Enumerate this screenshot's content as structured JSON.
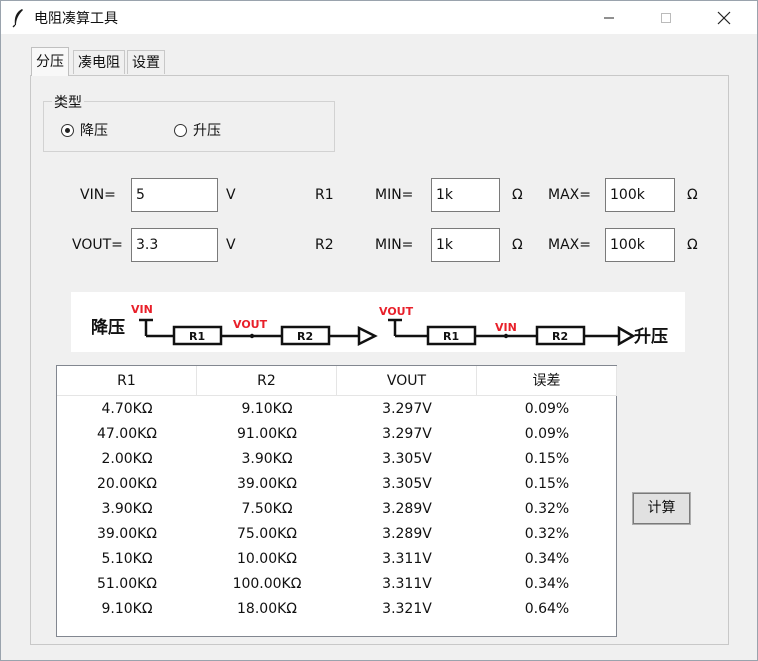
{
  "window": {
    "title": "电阻凑算工具",
    "min_icon": "minimize-icon",
    "max_icon": "maximize-icon",
    "close_icon": "close-icon"
  },
  "tabs": [
    {
      "label": "分压",
      "active": true
    },
    {
      "label": "凑电阻",
      "active": false
    },
    {
      "label": "设置",
      "active": false
    }
  ],
  "type_group": {
    "label": "类型",
    "options": [
      {
        "label": "降压",
        "checked": true
      },
      {
        "label": "升压",
        "checked": false
      }
    ]
  },
  "inputs": {
    "vin_label": "VIN=",
    "vin_value": "5",
    "vin_unit": "V",
    "vout_label": "VOUT=",
    "vout_value": "3.3",
    "vout_unit": "V",
    "r1_label": "R1",
    "r2_label": "R2",
    "min_label": "MIN=",
    "max_label": "MAX=",
    "r1_min": "1k",
    "r1_max": "100k",
    "r2_min": "1k",
    "r2_max": "100k",
    "ohm": "Ω"
  },
  "diagram": {
    "buck_label": "降压",
    "boost_label": "升压",
    "vin": "VIN",
    "vout": "VOUT",
    "r1": "R1",
    "r2": "R2",
    "red": "#e8202a"
  },
  "table": {
    "headers": [
      "R1",
      "R2",
      "VOUT",
      "误差"
    ],
    "rows": [
      [
        "4.70KΩ",
        "9.10KΩ",
        "3.297V",
        "0.09%"
      ],
      [
        "47.00KΩ",
        "91.00KΩ",
        "3.297V",
        "0.09%"
      ],
      [
        "2.00KΩ",
        "3.90KΩ",
        "3.305V",
        "0.15%"
      ],
      [
        "20.00KΩ",
        "39.00KΩ",
        "3.305V",
        "0.15%"
      ],
      [
        "3.90KΩ",
        "7.50KΩ",
        "3.289V",
        "0.32%"
      ],
      [
        "39.00KΩ",
        "75.00KΩ",
        "3.289V",
        "0.32%"
      ],
      [
        "5.10KΩ",
        "10.00KΩ",
        "3.311V",
        "0.34%"
      ],
      [
        "51.00KΩ",
        "100.00KΩ",
        "3.311V",
        "0.34%"
      ],
      [
        "9.10KΩ",
        "18.00KΩ",
        "3.321V",
        "0.64%"
      ]
    ]
  },
  "calc_button": "计算"
}
